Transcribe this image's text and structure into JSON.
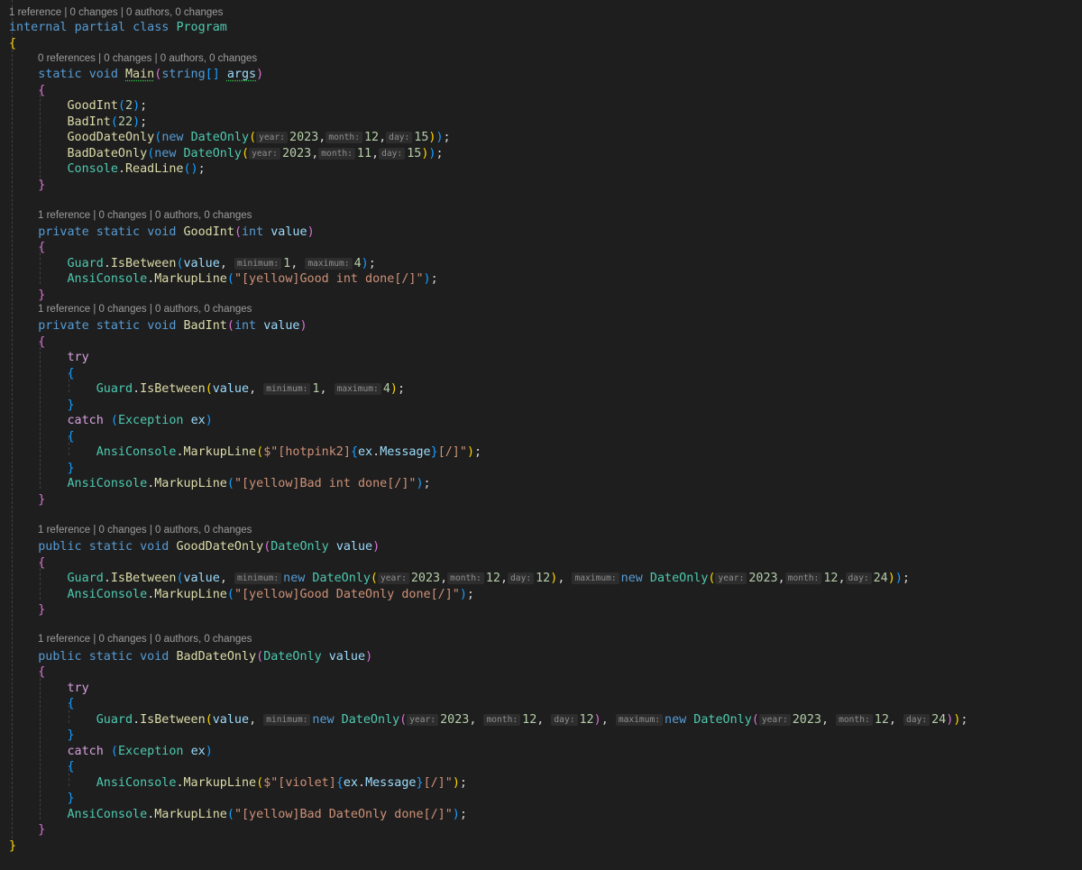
{
  "codelens": [
    "1 reference | 0 changes | 0 authors, 0 changes",
    "0 references | 0 changes | 0 authors, 0 changes",
    "1 reference | 0 changes | 0 authors, 0 changes",
    "1 reference | 0 changes | 0 authors, 0 changes",
    "1 reference | 0 changes | 0 authors, 0 changes",
    "1 reference | 0 changes | 0 authors, 0 changes"
  ],
  "code_lines": [
    [
      [
        "kw",
        "internal"
      ],
      [
        "pl",
        " "
      ],
      [
        "kw",
        "partial"
      ],
      [
        "pl",
        " "
      ],
      [
        "kw",
        "class"
      ],
      [
        "pl",
        " "
      ],
      [
        "type",
        "Program"
      ]
    ],
    [
      [
        "b1",
        "{"
      ]
    ],
    [
      [
        "pl",
        "    "
      ],
      [
        "kw",
        "static"
      ],
      [
        "pl",
        " "
      ],
      [
        "kw",
        "void"
      ],
      [
        "pl",
        " "
      ],
      [
        "fn",
        "Main",
        true
      ],
      [
        "b2",
        "("
      ],
      [
        "kw",
        "string"
      ],
      [
        "b3",
        "[]"
      ],
      [
        "pl",
        " "
      ],
      [
        "var",
        "args",
        true
      ],
      [
        "b2",
        ")"
      ]
    ],
    [
      [
        "pl",
        "    "
      ],
      [
        "b2",
        "{"
      ]
    ],
    [
      [
        "pl",
        "        "
      ],
      [
        "fn",
        "GoodInt"
      ],
      [
        "b3",
        "("
      ],
      [
        "num",
        "2"
      ],
      [
        "b3",
        ")"
      ],
      [
        "pl",
        ";"
      ]
    ],
    [
      [
        "pl",
        "        "
      ],
      [
        "fn",
        "BadInt"
      ],
      [
        "b3",
        "("
      ],
      [
        "num",
        "22"
      ],
      [
        "b3",
        ")"
      ],
      [
        "pl",
        ";"
      ]
    ],
    [
      [
        "pl",
        "        "
      ],
      [
        "fn",
        "GoodDateOnly"
      ],
      [
        "b3",
        "("
      ],
      [
        "kw",
        "new"
      ],
      [
        "pl",
        " "
      ],
      [
        "type",
        "DateOnly"
      ],
      [
        "b1",
        "("
      ],
      [
        "hint",
        "year:"
      ],
      [
        "num",
        "2023"
      ],
      [
        "pl",
        ","
      ],
      [
        "hint",
        "month:"
      ],
      [
        "num",
        "12"
      ],
      [
        "pl",
        ","
      ],
      [
        "hint",
        "day:"
      ],
      [
        "num",
        "15"
      ],
      [
        "b1",
        ")"
      ],
      [
        "b3",
        ")"
      ],
      [
        "pl",
        ";"
      ]
    ],
    [
      [
        "pl",
        "        "
      ],
      [
        "fn",
        "BadDateOnly"
      ],
      [
        "b3",
        "("
      ],
      [
        "kw",
        "new"
      ],
      [
        "pl",
        " "
      ],
      [
        "type",
        "DateOnly"
      ],
      [
        "b1",
        "("
      ],
      [
        "hint",
        "year:"
      ],
      [
        "num",
        "2023"
      ],
      [
        "pl",
        ","
      ],
      [
        "hint",
        "month:"
      ],
      [
        "num",
        "11"
      ],
      [
        "pl",
        ","
      ],
      [
        "hint",
        "day:"
      ],
      [
        "num",
        "15"
      ],
      [
        "b1",
        ")"
      ],
      [
        "b3",
        ")"
      ],
      [
        "pl",
        ";"
      ]
    ],
    [
      [
        "pl",
        "        "
      ],
      [
        "type",
        "Console"
      ],
      [
        "pl",
        "."
      ],
      [
        "fn",
        "ReadLine"
      ],
      [
        "b3",
        "()"
      ],
      [
        "pl",
        ";"
      ]
    ],
    [
      [
        "pl",
        "    "
      ],
      [
        "b2",
        "}"
      ]
    ],
    [
      [
        "pl",
        " "
      ]
    ],
    [
      [
        "pl",
        "    "
      ],
      [
        "kw",
        "private"
      ],
      [
        "pl",
        " "
      ],
      [
        "kw",
        "static"
      ],
      [
        "pl",
        " "
      ],
      [
        "kw",
        "void"
      ],
      [
        "pl",
        " "
      ],
      [
        "fn",
        "GoodInt"
      ],
      [
        "b2",
        "("
      ],
      [
        "kw",
        "int"
      ],
      [
        "pl",
        " "
      ],
      [
        "var",
        "value"
      ],
      [
        "b2",
        ")"
      ]
    ],
    [
      [
        "pl",
        "    "
      ],
      [
        "b2",
        "{"
      ]
    ],
    [
      [
        "pl",
        "        "
      ],
      [
        "type",
        "Guard"
      ],
      [
        "pl",
        "."
      ],
      [
        "fn",
        "IsBetween"
      ],
      [
        "b3",
        "("
      ],
      [
        "var",
        "value"
      ],
      [
        "pl",
        ", "
      ],
      [
        "hint",
        "minimum:"
      ],
      [
        "num",
        "1"
      ],
      [
        "pl",
        ", "
      ],
      [
        "hint",
        "maximum:"
      ],
      [
        "num",
        "4"
      ],
      [
        "b3",
        ")"
      ],
      [
        "pl",
        ";"
      ]
    ],
    [
      [
        "pl",
        "        "
      ],
      [
        "type",
        "AnsiConsole"
      ],
      [
        "pl",
        "."
      ],
      [
        "fn",
        "MarkupLine"
      ],
      [
        "b3",
        "("
      ],
      [
        "str",
        "\"[yellow]Good int done[/]\""
      ],
      [
        "b3",
        ")"
      ],
      [
        "pl",
        ";"
      ]
    ],
    [
      [
        "pl",
        "    "
      ],
      [
        "b2",
        "}"
      ]
    ],
    [
      [
        "pl",
        "    "
      ],
      [
        "kw",
        "private"
      ],
      [
        "pl",
        " "
      ],
      [
        "kw",
        "static"
      ],
      [
        "pl",
        " "
      ],
      [
        "kw",
        "void"
      ],
      [
        "pl",
        " "
      ],
      [
        "fn",
        "BadInt"
      ],
      [
        "b2",
        "("
      ],
      [
        "kw",
        "int"
      ],
      [
        "pl",
        " "
      ],
      [
        "var",
        "value"
      ],
      [
        "b2",
        ")"
      ]
    ],
    [
      [
        "pl",
        "    "
      ],
      [
        "b2",
        "{"
      ]
    ],
    [
      [
        "pl",
        "        "
      ],
      [
        "ctl",
        "try"
      ]
    ],
    [
      [
        "pl",
        "        "
      ],
      [
        "b3",
        "{"
      ]
    ],
    [
      [
        "pl",
        "            "
      ],
      [
        "type",
        "Guard"
      ],
      [
        "pl",
        "."
      ],
      [
        "fn",
        "IsBetween"
      ],
      [
        "b1",
        "("
      ],
      [
        "var",
        "value"
      ],
      [
        "pl",
        ", "
      ],
      [
        "hint",
        "minimum:"
      ],
      [
        "num",
        "1"
      ],
      [
        "pl",
        ", "
      ],
      [
        "hint",
        "maximum:"
      ],
      [
        "num",
        "4"
      ],
      [
        "b1",
        ")"
      ],
      [
        "pl",
        ";"
      ]
    ],
    [
      [
        "pl",
        "        "
      ],
      [
        "b3",
        "}"
      ]
    ],
    [
      [
        "pl",
        "        "
      ],
      [
        "ctl",
        "catch"
      ],
      [
        "pl",
        " "
      ],
      [
        "b3",
        "("
      ],
      [
        "type",
        "Exception"
      ],
      [
        "pl",
        " "
      ],
      [
        "var",
        "ex"
      ],
      [
        "b3",
        ")"
      ]
    ],
    [
      [
        "pl",
        "        "
      ],
      [
        "b3",
        "{"
      ]
    ],
    [
      [
        "pl",
        "            "
      ],
      [
        "type",
        "AnsiConsole"
      ],
      [
        "pl",
        "."
      ],
      [
        "fn",
        "MarkupLine"
      ],
      [
        "b1",
        "("
      ],
      [
        "str",
        "$\"[hotpink2]"
      ],
      [
        "b3",
        "{"
      ],
      [
        "var",
        "ex"
      ],
      [
        "pl",
        "."
      ],
      [
        "var",
        "Message"
      ],
      [
        "b3",
        "}"
      ],
      [
        "str",
        "[/]\""
      ],
      [
        "b1",
        ")"
      ],
      [
        "pl",
        ";"
      ]
    ],
    [
      [
        "pl",
        "        "
      ],
      [
        "b3",
        "}"
      ]
    ],
    [
      [
        "pl",
        "        "
      ],
      [
        "type",
        "AnsiConsole"
      ],
      [
        "pl",
        "."
      ],
      [
        "fn",
        "MarkupLine"
      ],
      [
        "b3",
        "("
      ],
      [
        "str",
        "\"[yellow]Bad int done[/]\""
      ],
      [
        "b3",
        ")"
      ],
      [
        "pl",
        ";"
      ]
    ],
    [
      [
        "pl",
        "    "
      ],
      [
        "b2",
        "}"
      ]
    ],
    [
      [
        "pl",
        " "
      ]
    ],
    [
      [
        "pl",
        "    "
      ],
      [
        "kw",
        "public"
      ],
      [
        "pl",
        " "
      ],
      [
        "kw",
        "static"
      ],
      [
        "pl",
        " "
      ],
      [
        "kw",
        "void"
      ],
      [
        "pl",
        " "
      ],
      [
        "fn",
        "GoodDateOnly"
      ],
      [
        "b2",
        "("
      ],
      [
        "type",
        "DateOnly"
      ],
      [
        "pl",
        " "
      ],
      [
        "var",
        "value"
      ],
      [
        "b2",
        ")"
      ]
    ],
    [
      [
        "pl",
        "    "
      ],
      [
        "b2",
        "{"
      ]
    ],
    [
      [
        "pl",
        "        "
      ],
      [
        "type",
        "Guard"
      ],
      [
        "pl",
        "."
      ],
      [
        "fn",
        "IsBetween"
      ],
      [
        "b3",
        "("
      ],
      [
        "var",
        "value"
      ],
      [
        "pl",
        ", "
      ],
      [
        "hint",
        "minimum:"
      ],
      [
        "kw",
        "new"
      ],
      [
        "pl",
        " "
      ],
      [
        "type",
        "DateOnly"
      ],
      [
        "b1",
        "("
      ],
      [
        "hint",
        "year:"
      ],
      [
        "num",
        "2023"
      ],
      [
        "pl",
        ","
      ],
      [
        "hint",
        "month:"
      ],
      [
        "num",
        "12"
      ],
      [
        "pl",
        ","
      ],
      [
        "hint",
        "day:"
      ],
      [
        "num",
        "12"
      ],
      [
        "b1",
        ")"
      ],
      [
        "pl",
        ", "
      ],
      [
        "hint",
        "maximum:"
      ],
      [
        "kw",
        "new"
      ],
      [
        "pl",
        " "
      ],
      [
        "type",
        "DateOnly"
      ],
      [
        "b1",
        "("
      ],
      [
        "hint",
        "year:"
      ],
      [
        "num",
        "2023"
      ],
      [
        "pl",
        ","
      ],
      [
        "hint",
        "month:"
      ],
      [
        "num",
        "12"
      ],
      [
        "pl",
        ","
      ],
      [
        "hint",
        "day:"
      ],
      [
        "num",
        "24"
      ],
      [
        "b1",
        ")"
      ],
      [
        "b3",
        ")"
      ],
      [
        "pl",
        ";"
      ]
    ],
    [
      [
        "pl",
        "        "
      ],
      [
        "type",
        "AnsiConsole"
      ],
      [
        "pl",
        "."
      ],
      [
        "fn",
        "MarkupLine"
      ],
      [
        "b3",
        "("
      ],
      [
        "str",
        "\"[yellow]Good DateOnly done[/]\""
      ],
      [
        "b3",
        ")"
      ],
      [
        "pl",
        ";"
      ]
    ],
    [
      [
        "pl",
        "    "
      ],
      [
        "b2",
        "}"
      ]
    ],
    [
      [
        "pl",
        " "
      ]
    ],
    [
      [
        "pl",
        "    "
      ],
      [
        "kw",
        "public"
      ],
      [
        "pl",
        " "
      ],
      [
        "kw",
        "static"
      ],
      [
        "pl",
        " "
      ],
      [
        "kw",
        "void"
      ],
      [
        "pl",
        " "
      ],
      [
        "fn",
        "BadDateOnly"
      ],
      [
        "b2",
        "("
      ],
      [
        "type",
        "DateOnly"
      ],
      [
        "pl",
        " "
      ],
      [
        "var",
        "value"
      ],
      [
        "b2",
        ")"
      ]
    ],
    [
      [
        "pl",
        "    "
      ],
      [
        "b2",
        "{"
      ]
    ],
    [
      [
        "pl",
        "        "
      ],
      [
        "ctl",
        "try"
      ]
    ],
    [
      [
        "pl",
        "        "
      ],
      [
        "b3",
        "{"
      ]
    ],
    [
      [
        "pl",
        "            "
      ],
      [
        "type",
        "Guard"
      ],
      [
        "pl",
        "."
      ],
      [
        "fn",
        "IsBetween"
      ],
      [
        "b1",
        "("
      ],
      [
        "var",
        "value"
      ],
      [
        "pl",
        ", "
      ],
      [
        "hint",
        "minimum:"
      ],
      [
        "kw",
        "new"
      ],
      [
        "pl",
        " "
      ],
      [
        "type",
        "DateOnly"
      ],
      [
        "b2",
        "("
      ],
      [
        "hint",
        "year:"
      ],
      [
        "num",
        "2023"
      ],
      [
        "pl",
        ", "
      ],
      [
        "hint",
        "month:"
      ],
      [
        "num",
        "12"
      ],
      [
        "pl",
        ", "
      ],
      [
        "hint",
        "day:"
      ],
      [
        "num",
        "12"
      ],
      [
        "b2",
        ")"
      ],
      [
        "pl",
        ", "
      ],
      [
        "hint",
        "maximum:"
      ],
      [
        "kw",
        "new"
      ],
      [
        "pl",
        " "
      ],
      [
        "type",
        "DateOnly"
      ],
      [
        "b2",
        "("
      ],
      [
        "hint",
        "year:"
      ],
      [
        "num",
        "2023"
      ],
      [
        "pl",
        ", "
      ],
      [
        "hint",
        "month:"
      ],
      [
        "num",
        "12"
      ],
      [
        "pl",
        ", "
      ],
      [
        "hint",
        "day:"
      ],
      [
        "num",
        "24"
      ],
      [
        "b2",
        ")"
      ],
      [
        "b1",
        ")"
      ],
      [
        "pl",
        ";"
      ]
    ],
    [
      [
        "pl",
        "        "
      ],
      [
        "b3",
        "}"
      ]
    ],
    [
      [
        "pl",
        "        "
      ],
      [
        "ctl",
        "catch"
      ],
      [
        "pl",
        " "
      ],
      [
        "b3",
        "("
      ],
      [
        "type",
        "Exception"
      ],
      [
        "pl",
        " "
      ],
      [
        "var",
        "ex"
      ],
      [
        "b3",
        ")"
      ]
    ],
    [
      [
        "pl",
        "        "
      ],
      [
        "b3",
        "{"
      ]
    ],
    [
      [
        "pl",
        "            "
      ],
      [
        "type",
        "AnsiConsole"
      ],
      [
        "pl",
        "."
      ],
      [
        "fn",
        "MarkupLine"
      ],
      [
        "b1",
        "("
      ],
      [
        "str",
        "$\"[violet]"
      ],
      [
        "b3",
        "{"
      ],
      [
        "var",
        "ex"
      ],
      [
        "pl",
        "."
      ],
      [
        "var",
        "Message"
      ],
      [
        "b3",
        "}"
      ],
      [
        "str",
        "[/]\""
      ],
      [
        "b1",
        ")"
      ],
      [
        "pl",
        ";"
      ]
    ],
    [
      [
        "pl",
        "        "
      ],
      [
        "b3",
        "}"
      ]
    ],
    [
      [
        "pl",
        "        "
      ],
      [
        "type",
        "AnsiConsole"
      ],
      [
        "pl",
        "."
      ],
      [
        "fn",
        "MarkupLine"
      ],
      [
        "b3",
        "("
      ],
      [
        "str",
        "\"[yellow]Bad DateOnly done[/]\""
      ],
      [
        "b3",
        ")"
      ],
      [
        "pl",
        ";"
      ]
    ],
    [
      [
        "pl",
        "    "
      ],
      [
        "b2",
        "}"
      ]
    ],
    [
      [
        "b1",
        "}"
      ]
    ]
  ],
  "colors": {
    "background": "#1e1e1e",
    "keyword": "#569cd6",
    "control_keyword": "#d8a0df",
    "type": "#4ec9b0",
    "method": "#dcdcaa",
    "variable": "#9cdcfe",
    "number": "#b5cea8",
    "string": "#ce9178",
    "bracket_1": "#ffd700",
    "bracket_2": "#da70d6",
    "bracket_3": "#179fff",
    "codelens": "#9d9d9d",
    "inlay_hint_background": "#2d2d2d"
  }
}
